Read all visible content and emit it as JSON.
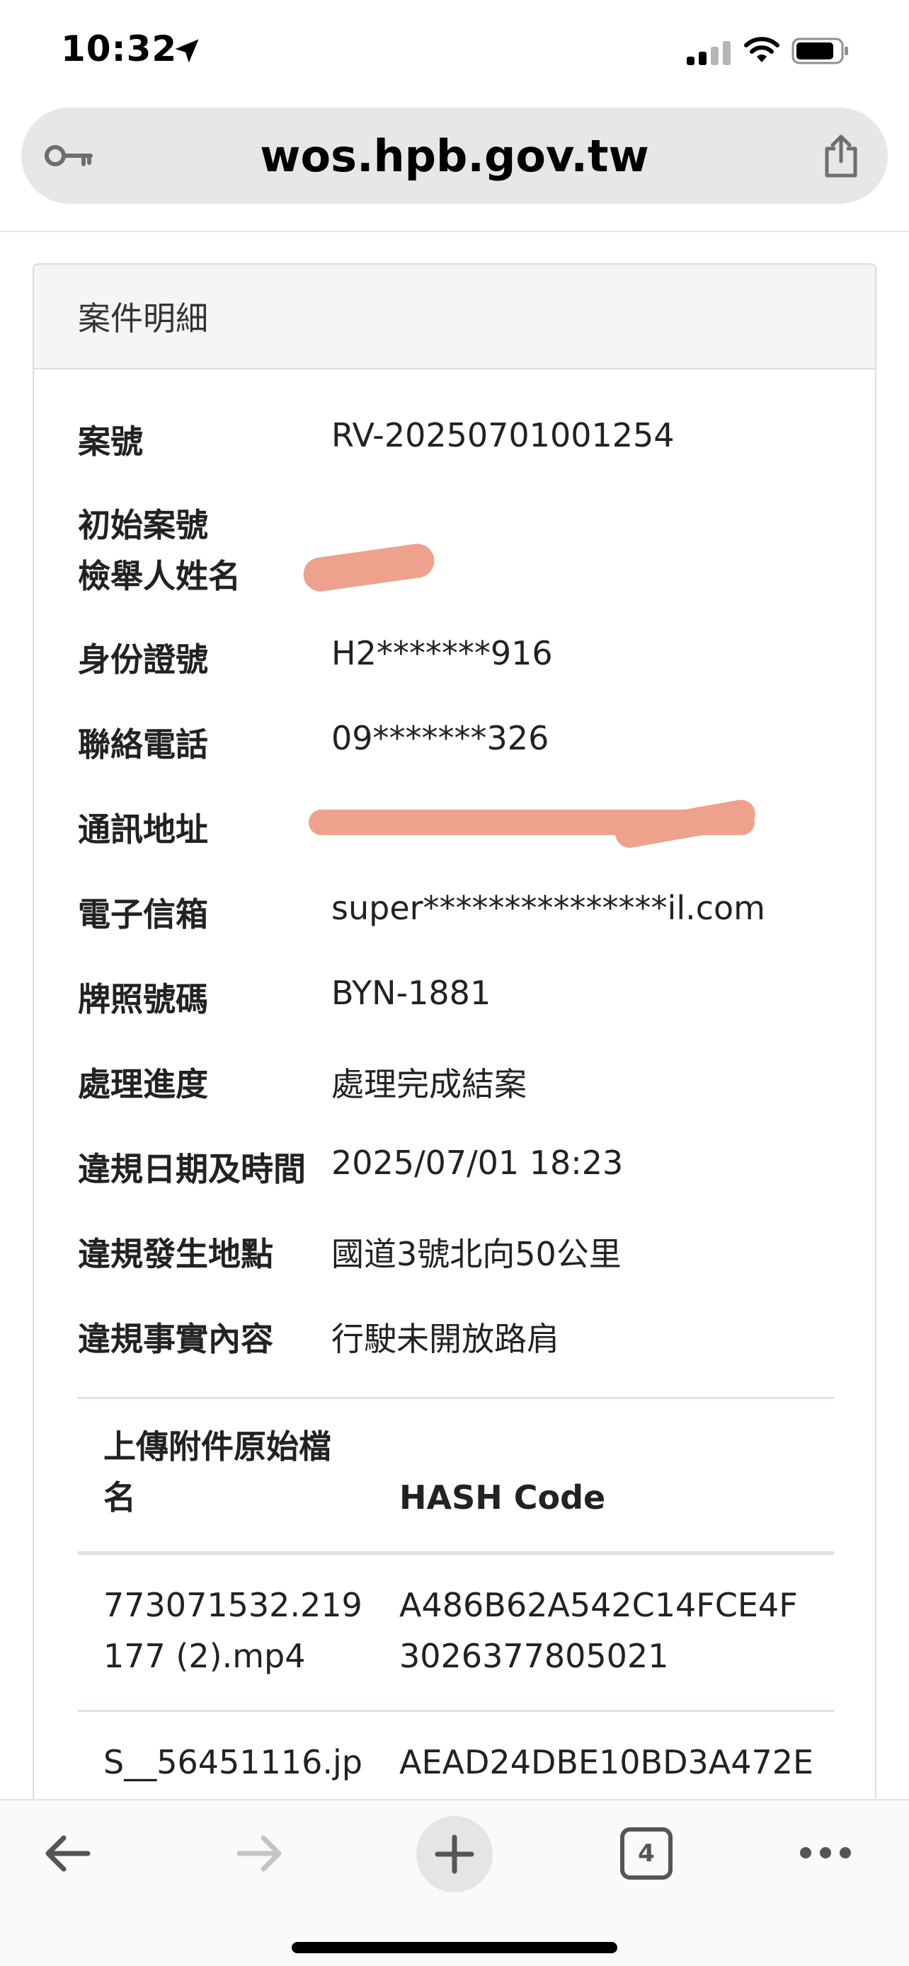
{
  "status_bar": {
    "time": "10:32"
  },
  "browser": {
    "url": "wos.hpb.gov.tw",
    "tab_count": "4"
  },
  "card": {
    "title": "案件明細",
    "fields": {
      "case_no": {
        "label": "案號",
        "value": "RV-20250701001254"
      },
      "initial_case_no": {
        "label": "初始案號",
        "value": ""
      },
      "reporter_name": {
        "label": "檢舉人姓名",
        "value": ""
      },
      "id_number": {
        "label": "身份證號",
        "value": "H2*******916"
      },
      "phone": {
        "label": "聯絡電話",
        "value": "09*******326"
      },
      "address": {
        "label": "通訊地址",
        "value": ""
      },
      "email": {
        "label": "電子信箱",
        "value": "super***************il.com"
      },
      "plate": {
        "label": "牌照號碼",
        "value": "BYN-1881"
      },
      "progress": {
        "label": "處理進度",
        "value": "處理完成結案"
      },
      "violation_datetime": {
        "label": "違規日期及時間",
        "value": "2025/07/01 18:23"
      },
      "violation_location": {
        "label": "違規發生地點",
        "value": "國道3號北向50公里"
      },
      "violation_content": {
        "label": "違規事實內容",
        "value": "行駛未開放路肩"
      }
    },
    "attachments": {
      "headers": {
        "filename_line1": "上傳附件原始檔",
        "filename_line2": "名",
        "hash": "HASH Code"
      },
      "rows": [
        {
          "file_line1": "773071532.219",
          "file_line2": "177 (2).mp4",
          "hash_line1": "A486B62A542C14FCE4F",
          "hash_line2": "3026377805021"
        },
        {
          "file_line1": "S__56451116.jp",
          "file_line2": "",
          "hash_line1": "AEAD24DBE10BD3A472E",
          "hash_line2": ""
        }
      ]
    }
  },
  "colors": {
    "redaction": "#eea18c",
    "card_border": "#dcdcdc",
    "header_bg": "#f5f5f5"
  }
}
